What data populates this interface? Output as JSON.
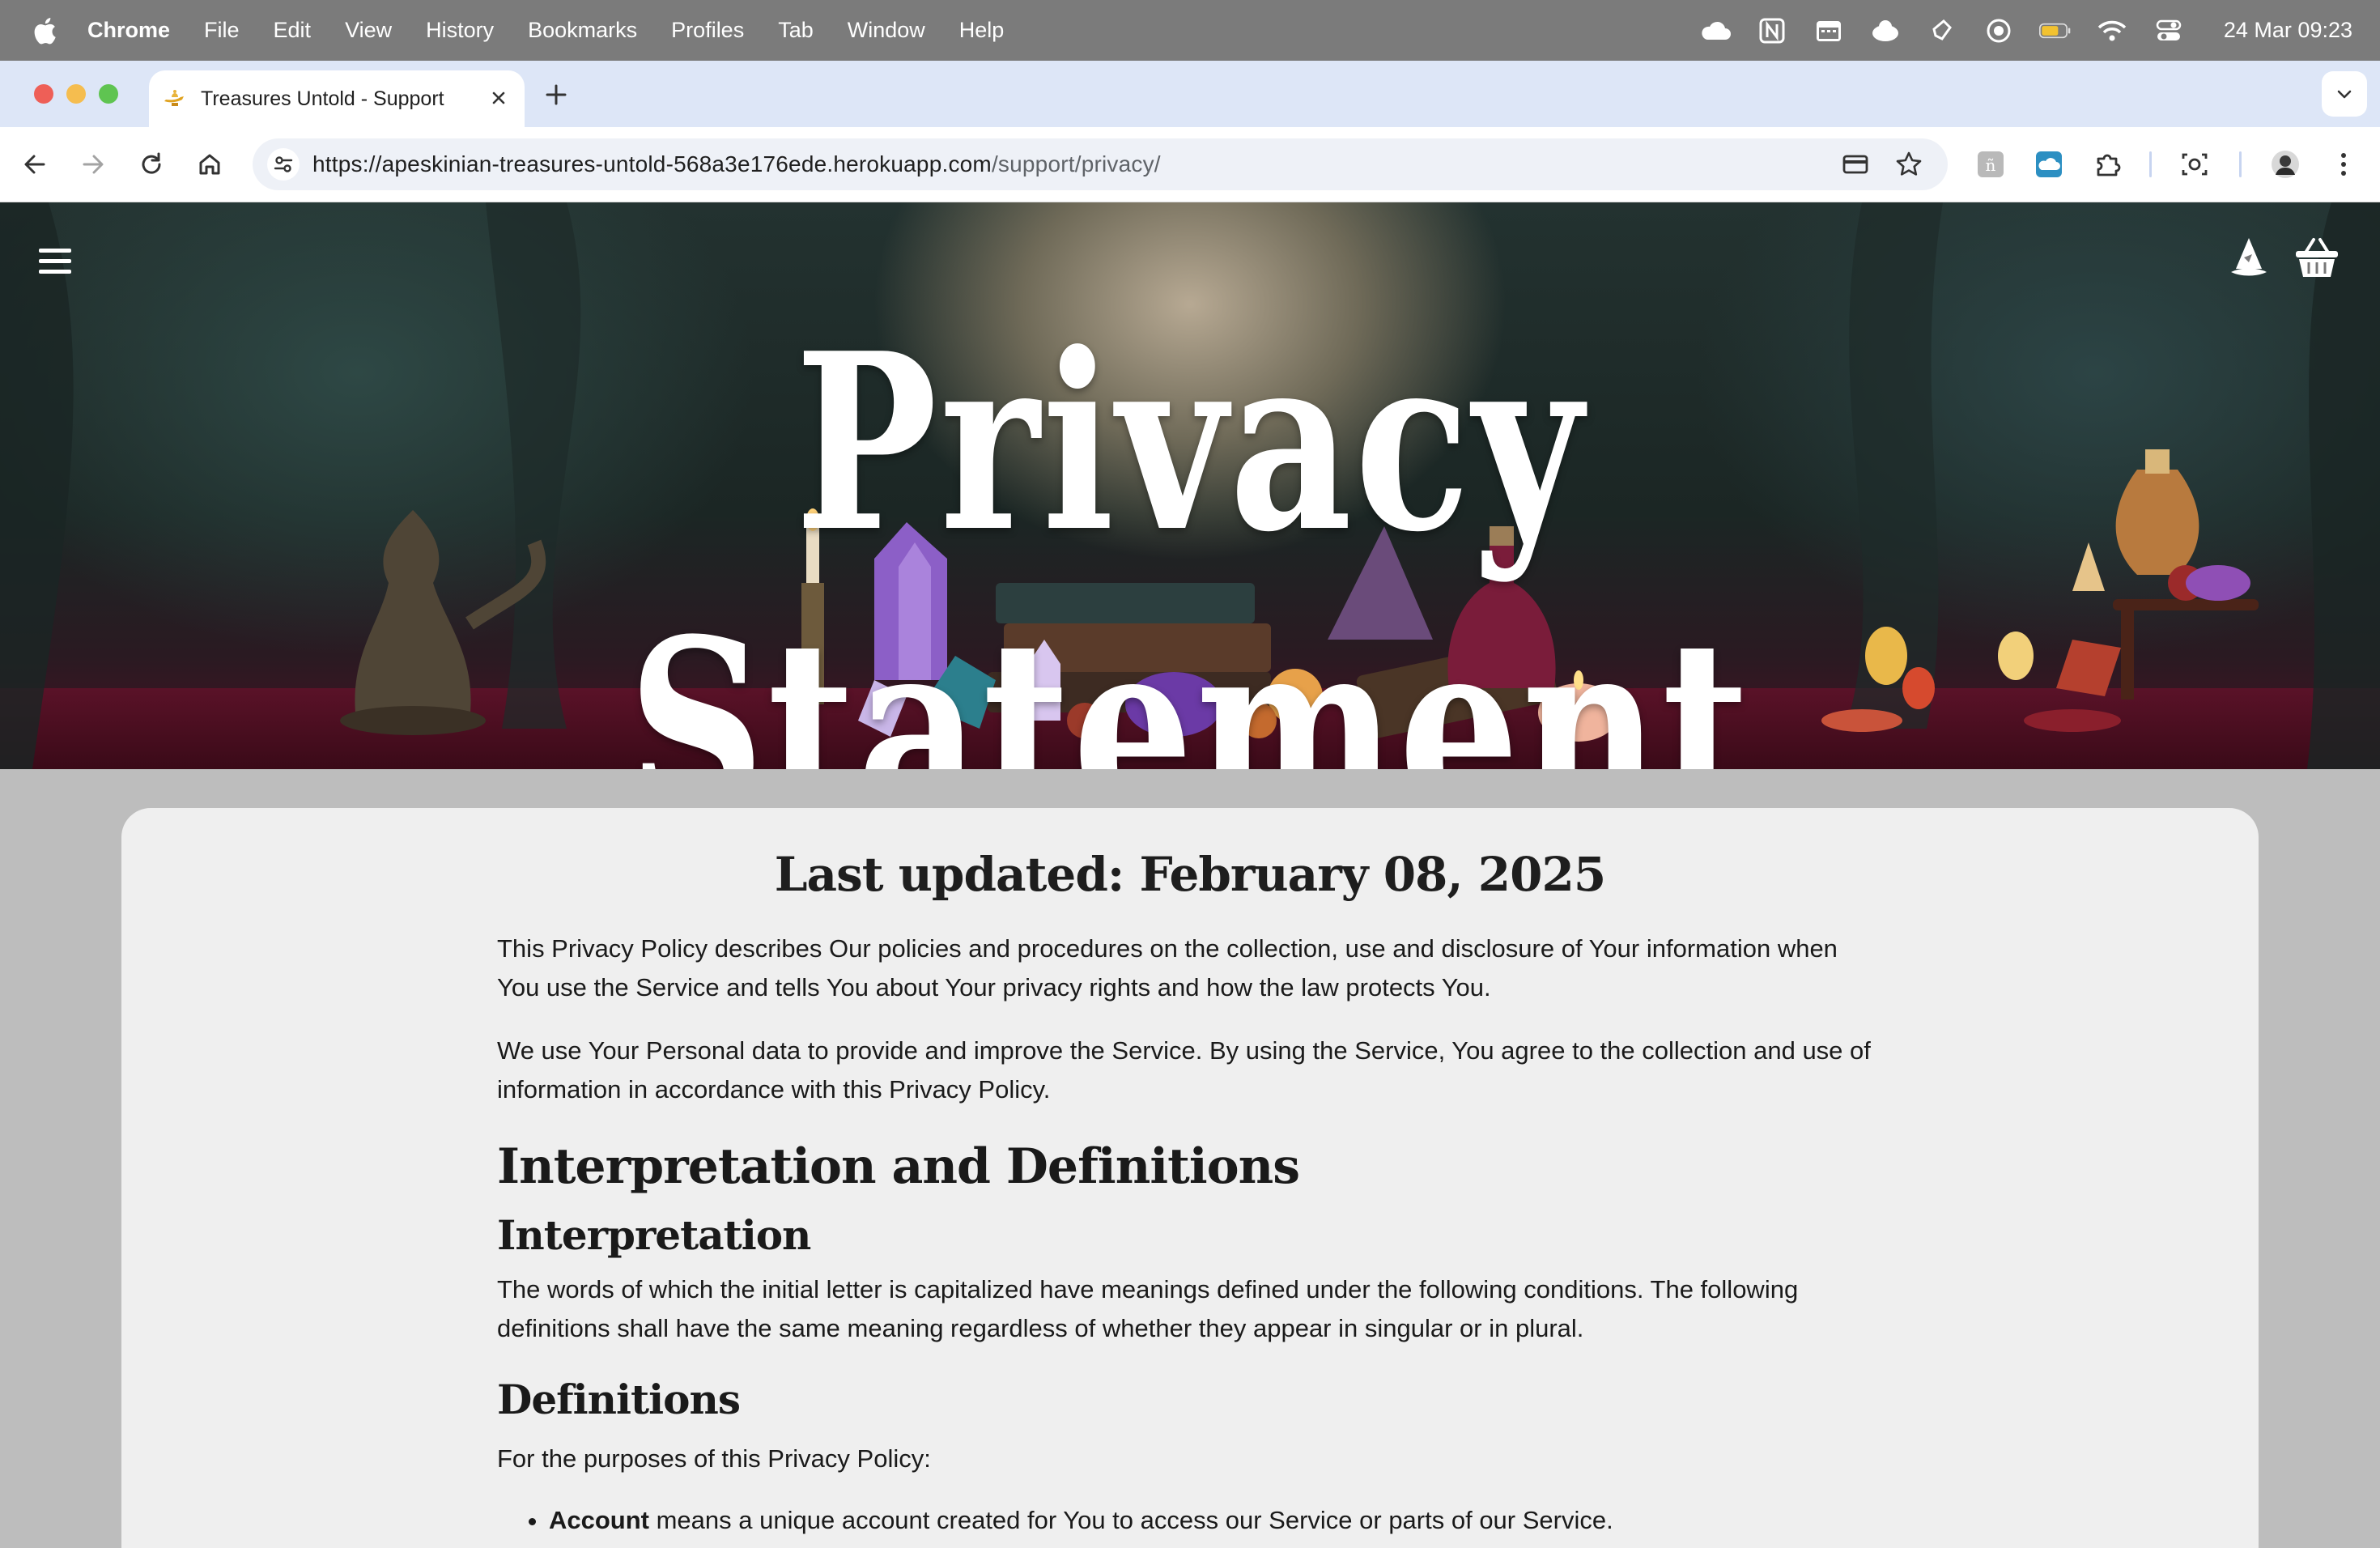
{
  "menubar": {
    "app": "Chrome",
    "items": [
      "File",
      "Edit",
      "View",
      "History",
      "Bookmarks",
      "Profiles",
      "Tab",
      "Window",
      "Help"
    ],
    "clock": "24 Mar  09:23"
  },
  "browser": {
    "tab_title": "Treasures Untold - Support",
    "url_host": "https://apeskinian-treasures-untold-568a3e176ede.herokuapp.com",
    "url_path": "/support/privacy/"
  },
  "hero": {
    "title": "Privacy Statement"
  },
  "content": {
    "updated": "Last updated: February 08, 2025",
    "intro1": "This Privacy Policy describes Our policies and procedures on the collection, use and disclosure of Your information when You use the Service and tells You about Your privacy rights and how the law protects You.",
    "intro2": "We use Your Personal data to provide and improve the Service. By using the Service, You agree to the collection and use of information in accordance with this Privacy Policy.",
    "heading_interp_defs": "Interpretation and Definitions",
    "heading_interpretation": "Interpretation",
    "interpretation_text": "The words of which the initial letter is capitalized have meanings defined under the following conditions. The following definitions shall have the same meaning regardless of whether they appear in singular or in plural.",
    "heading_definitions": "Definitions",
    "definitions_intro": "For the purposes of this Privacy Policy:",
    "definitions": [
      {
        "term": "Account",
        "text": " means a unique account created for You to access our Service or parts of our Service."
      }
    ]
  }
}
